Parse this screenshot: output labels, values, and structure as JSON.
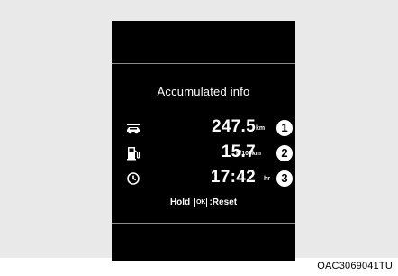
{
  "display": {
    "title": "Accumulated info",
    "rows": [
      {
        "icon": "distance-icon",
        "value": "247.5",
        "unit": "km",
        "badge": "1"
      },
      {
        "icon": "fuel-pump-icon",
        "value": "15.7",
        "unit": "L/100km",
        "badge": "2"
      },
      {
        "icon": "clock-icon",
        "value": "17:42",
        "unit": "hr",
        "badge": "3"
      }
    ],
    "reset": {
      "hold": "Hold",
      "ok": "OK",
      "action": ":Reset"
    }
  },
  "figure_code": "OAC3069041TU",
  "colors": {
    "screen": "#000000",
    "text": "#ffffff",
    "frame": "#e9e9e9"
  }
}
